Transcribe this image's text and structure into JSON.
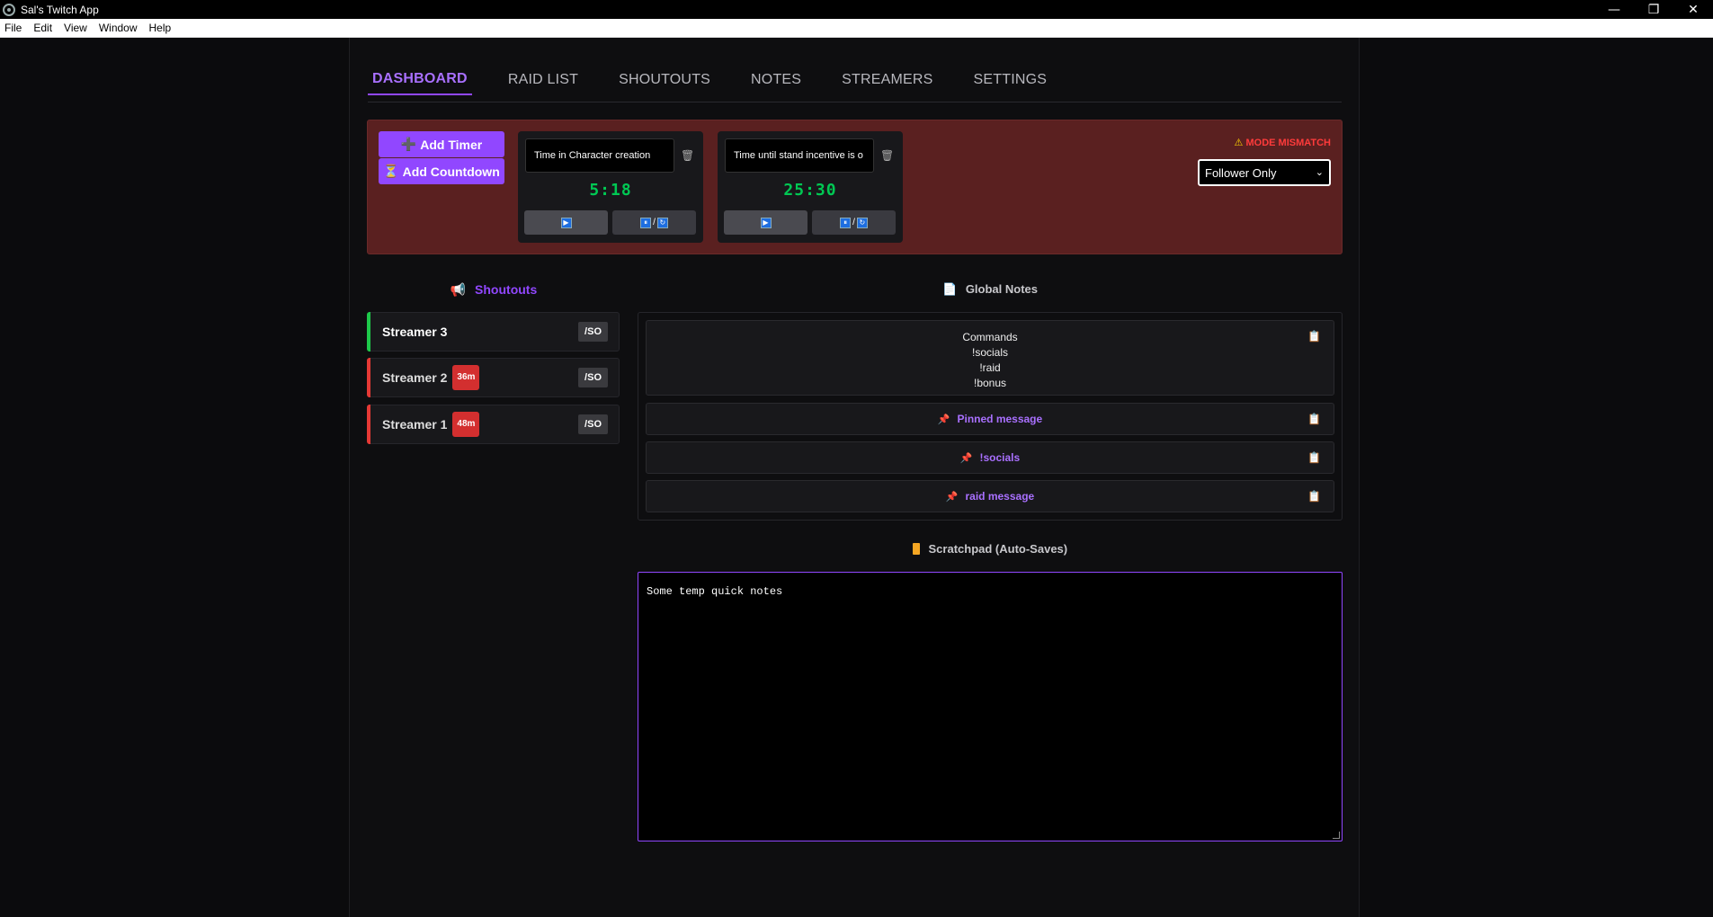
{
  "window": {
    "title": "Sal's Twitch App",
    "minimize": "—",
    "maximize": "❐",
    "close": "✕"
  },
  "menu": [
    "File",
    "Edit",
    "View",
    "Window",
    "Help"
  ],
  "tabs": [
    "DASHBOARD",
    "RAID LIST",
    "SHOUTOUTS",
    "NOTES",
    "STREAMERS",
    "SETTINGS"
  ],
  "timers": {
    "add_timer": "Add Timer",
    "add_countdown": "Add Countdown",
    "cards": [
      {
        "label": "Time in Character creation",
        "value": "5:18"
      },
      {
        "label": "Time until stand incentive is o",
        "value": "25:30"
      }
    ],
    "pause_reset_sep": "/",
    "mode_warning": "MODE MISMATCH",
    "mode_selected": "Follower Only"
  },
  "shoutouts": {
    "heading": "Shoutouts",
    "button": "/SO",
    "items": [
      {
        "name": "Streamer 3",
        "badge": "",
        "status_color": "#1ec84a"
      },
      {
        "name": "Streamer 2",
        "badge": "36m",
        "status_color": "#e53935"
      },
      {
        "name": "Streamer 1",
        "badge": "48m",
        "status_color": "#e53935"
      }
    ]
  },
  "global_notes": {
    "heading": "Global Notes",
    "commands_lines": [
      "Commands",
      "!socials",
      "!raid",
      "!bonus"
    ],
    "pinned": [
      "Pinned message",
      "!socials",
      "raid message"
    ]
  },
  "scratchpad": {
    "heading": "Scratchpad (Auto-Saves)",
    "text": "Some temp quick notes"
  },
  "colors": {
    "accent": "#9147ff",
    "timer_green": "#00c853",
    "warning_red": "#ff3b3b",
    "timer_bar_bg": "#5a2020"
  }
}
